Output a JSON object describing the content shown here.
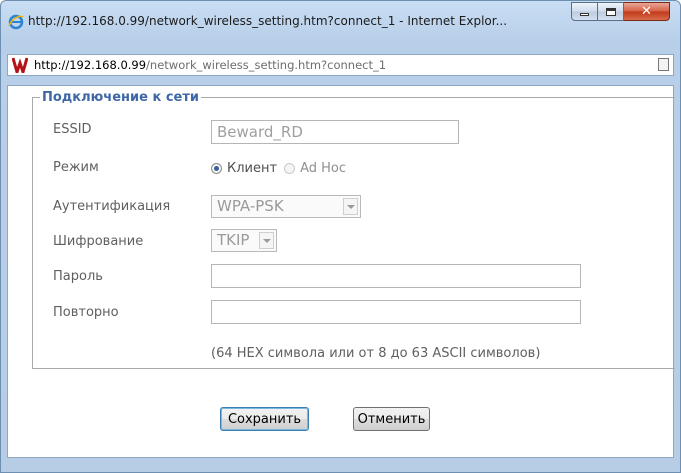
{
  "window": {
    "title": "http://192.168.0.99/network_wireless_setting.htm?connect_1 - Internet Explor...",
    "address_host": "http://192.168.0.99",
    "address_path": "/network_wireless_setting.htm?connect_1"
  },
  "form": {
    "group_title": "Подключение к сети",
    "essid_label": "ESSID",
    "essid_value": "Beward_RD",
    "mode_label": "Режим",
    "mode_options": [
      "Клиент",
      "Ad Hoc"
    ],
    "mode_selected": "Клиент",
    "auth_label": "Аутентификация",
    "auth_value": "WPA-PSK",
    "encryption_label": "Шифрование",
    "encryption_value": "TKIP",
    "password_label": "Пароль",
    "password_value": "",
    "repeat_label": "Повторно",
    "repeat_value": "",
    "hint": "(64 HEX символа или от 8 до 63 ASCII символов)"
  },
  "buttons": {
    "save": "Сохранить",
    "cancel": "Отменить"
  },
  "icons": {
    "browser": "internet-explorer-icon",
    "site": "site-favicon",
    "page": "page-icon"
  }
}
